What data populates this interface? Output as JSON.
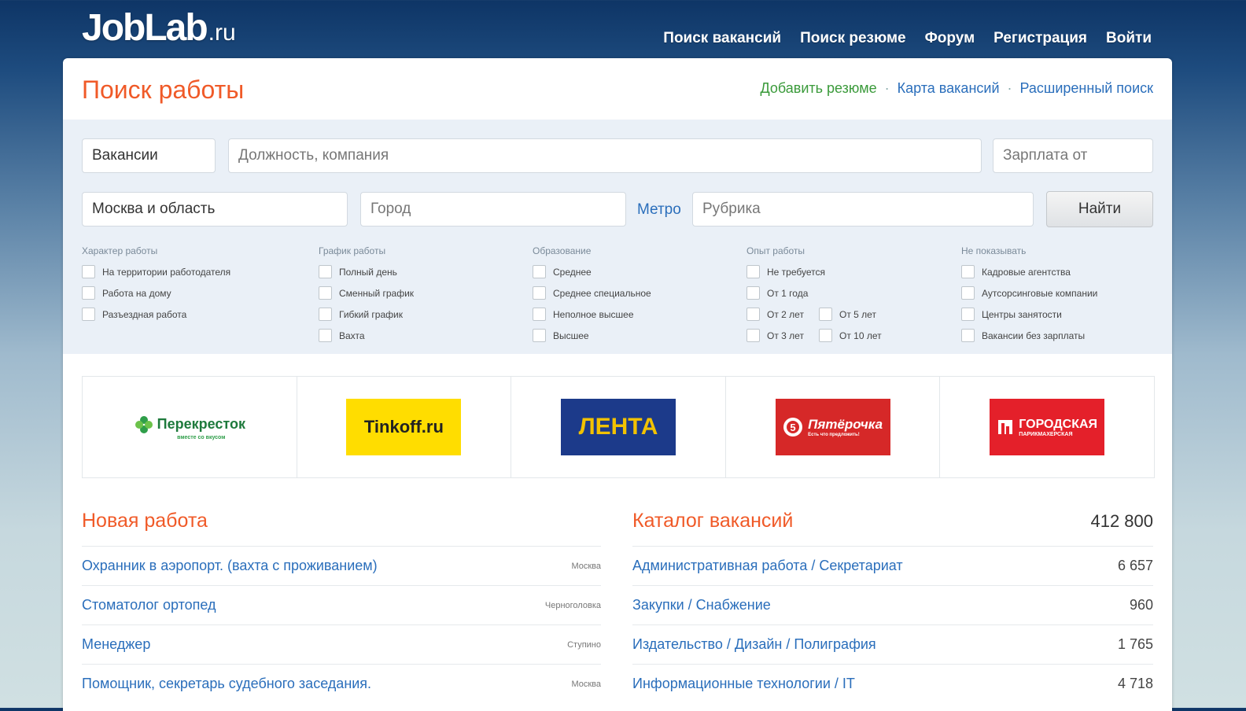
{
  "header": {
    "logo_main": "JobLab",
    "logo_tld": ".ru",
    "nav": [
      "Поиск вакансий",
      "Поиск резюме",
      "Форум",
      "Регистрация",
      "Войти"
    ]
  },
  "page": {
    "title": "Поиск работы",
    "links": [
      {
        "label": "Добавить резюме",
        "color": "#3a9a3a"
      },
      {
        "label": "Карта вакансий",
        "color": "#2a6ebb"
      },
      {
        "label": "Расширенный поиск",
        "color": "#2a6ebb"
      }
    ],
    "separator": "·"
  },
  "search": {
    "type_value": "Вакансии",
    "query_placeholder": "Должность, компания",
    "salary_placeholder": "Зарплата от",
    "region_value": "Москва и область",
    "city_placeholder": "Город",
    "metro_label": "Метро",
    "rubric_placeholder": "Рубрика",
    "submit_label": "Найти"
  },
  "filters": [
    {
      "title": "Характер работы",
      "items": [
        "На территории работодателя",
        "Работа на дому",
        "Разъездная работа"
      ]
    },
    {
      "title": "График работы",
      "items": [
        "Полный день",
        "Сменный график",
        "Гибкий график",
        "Вахта"
      ]
    },
    {
      "title": "Образование",
      "items": [
        "Среднее",
        "Среднее специальное",
        "Неполное высшее",
        "Высшее"
      ]
    },
    {
      "title": "Опыт работы",
      "items": [
        "Не требуется",
        "От 1 года"
      ],
      "pairs": [
        [
          "От 2 лет",
          "От 5 лет"
        ],
        [
          "От 3 лет",
          "От 10 лет"
        ]
      ]
    },
    {
      "title": "Не показывать",
      "items": [
        "Кадровые агентства",
        "Аутсорсинговые компании",
        "Центры занятости",
        "Вакансии без зарплаты"
      ]
    }
  ],
  "brands": [
    {
      "name": "Перекресток",
      "sub": "вместе со вкусом",
      "bg": "#ffffff",
      "fg": "#1e7a3c"
    },
    {
      "name": "Tinkoff.ru",
      "bg": "#ffdd00",
      "fg": "#222222"
    },
    {
      "name": "ЛЕНТА",
      "bg": "#1c3a8a",
      "fg": "#f2c200"
    },
    {
      "name": "Пятёрочка",
      "sub": "Есть что предложить!",
      "bg": "#d62828",
      "fg": "#ffffff"
    },
    {
      "name": "ГОРОДСКАЯ",
      "sub": "ПАРИКМАХЕРСКАЯ",
      "bg": "#e4202a",
      "fg": "#ffffff"
    }
  ],
  "new_jobs": {
    "title": "Новая работа",
    "items": [
      {
        "title": "Охранник в аэропорт. (вахта с проживанием)",
        "city": "Москва"
      },
      {
        "title": "Стоматолог ортопед",
        "city": "Черноголовка"
      },
      {
        "title": "Менеджер",
        "city": "Ступино"
      },
      {
        "title": "Помощник, секретарь судебного заседания.",
        "city": "Москва"
      }
    ]
  },
  "catalog": {
    "title": "Каталог вакансий",
    "total": "412 800",
    "items": [
      {
        "title": "Административная работа / Секретариат",
        "count": "6 657"
      },
      {
        "title": "Закупки / Снабжение",
        "count": "960"
      },
      {
        "title": "Издательство / Дизайн / Полиграфия",
        "count": "1 765"
      },
      {
        "title": "Информационные технологии / IT",
        "count": "4 718"
      }
    ]
  }
}
